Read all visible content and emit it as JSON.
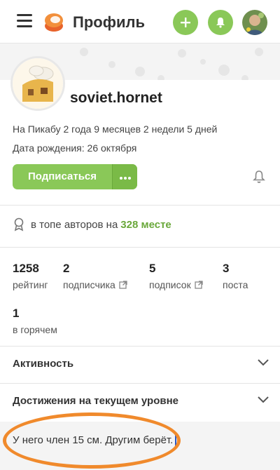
{
  "header": {
    "title": "Профиль",
    "icons": [
      "menu-icon",
      "pikabu-logo-icon",
      "plus-icon",
      "bell-icon",
      "user-avatar"
    ]
  },
  "profile": {
    "username": "soviet.hornet",
    "on_site": "На Пикабу 2 года 9 месяцев 2 недели 5 дней",
    "birthday": "Дата рождения: 26 октября",
    "subscribe_label": "Подписаться"
  },
  "rank": {
    "prefix": "в топе авторов на",
    "place": "328 месте"
  },
  "stats": [
    {
      "value": "1258",
      "label": "рейтинг"
    },
    {
      "value": "2",
      "label": "подписчика"
    },
    {
      "value": "5",
      "label": "подписок"
    },
    {
      "value": "3",
      "label": "поста"
    },
    {
      "value": "1",
      "label": "в горячем"
    }
  ],
  "sections": {
    "activity": "Активность",
    "achievements": "Достижения на текущем уровне"
  },
  "comment": {
    "text": "У него член 15 см. Другим берёт."
  },
  "colors": {
    "accent": "#8ac858",
    "accent_text": "#6aa83b",
    "annotation": "#f08a2c"
  }
}
